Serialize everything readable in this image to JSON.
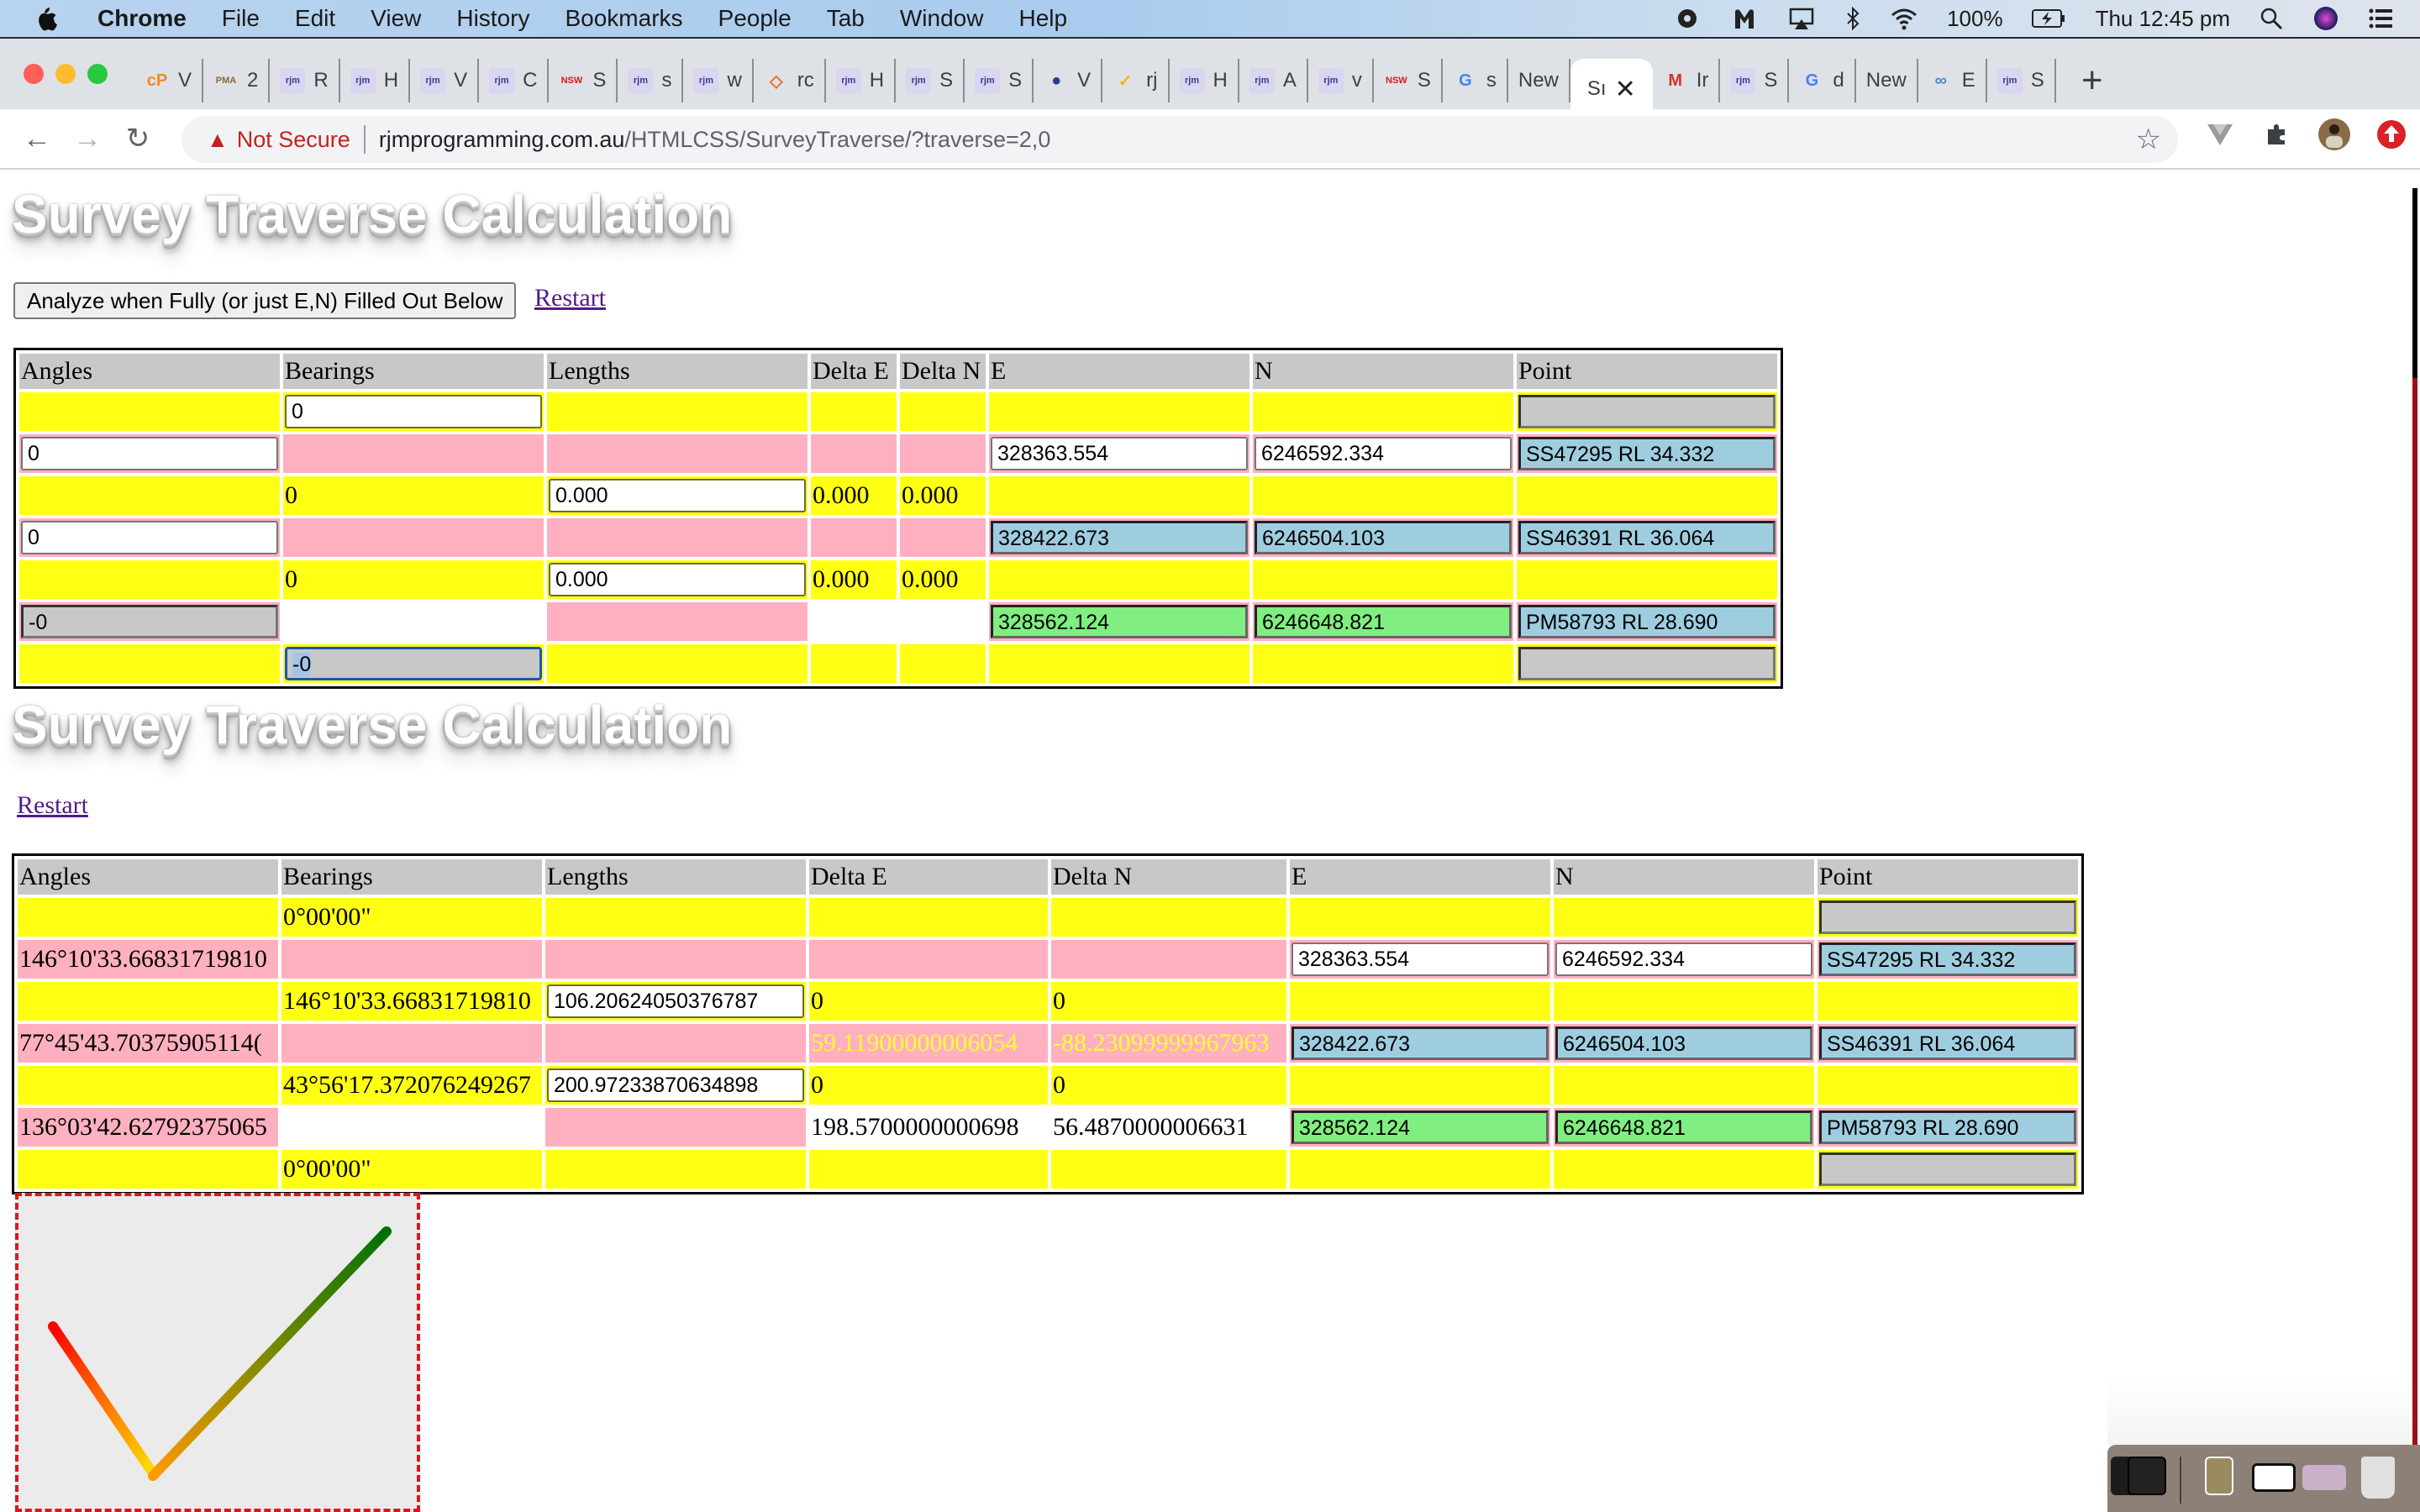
{
  "menubar": {
    "app": "Chrome",
    "items": [
      "File",
      "Edit",
      "View",
      "History",
      "Bookmarks",
      "People",
      "Tab",
      "Window",
      "Help"
    ],
    "battery": "100%",
    "clock": "Thu 12:45 pm"
  },
  "tabs": [
    {
      "fav": "cP",
      "label": "V",
      "color": "#f08a24"
    },
    {
      "fav": "PMA",
      "label": "2",
      "color": "#8a6a3a"
    },
    {
      "fav": "rjm",
      "label": "R",
      "color": "#3a3a8a"
    },
    {
      "fav": "rjm",
      "label": "H",
      "color": "#3a3a8a"
    },
    {
      "fav": "rjm",
      "label": "V",
      "color": "#3a3a8a"
    },
    {
      "fav": "rjm",
      "label": "C",
      "color": "#3a3a8a"
    },
    {
      "fav": "NSW",
      "label": "S",
      "color": "#d7191c"
    },
    {
      "fav": "rjm",
      "label": "s",
      "color": "#3a3a8a"
    },
    {
      "fav": "rjm",
      "label": "w",
      "color": "#3a3a8a"
    },
    {
      "fav": "◇",
      "label": "rc",
      "color": "#f06a24"
    },
    {
      "fav": "rjm",
      "label": "H",
      "color": "#3a3a8a"
    },
    {
      "fav": "rjm",
      "label": "S",
      "color": "#3a3a8a"
    },
    {
      "fav": "rjm",
      "label": "S",
      "color": "#3a3a8a"
    },
    {
      "fav": "●",
      "label": "V",
      "color": "#2a3f8a"
    },
    {
      "fav": "✓",
      "label": "rj",
      "color": "#f2b418"
    },
    {
      "fav": "rjm",
      "label": "H",
      "color": "#3a3a8a"
    },
    {
      "fav": "rjm",
      "label": "A",
      "color": "#3a3a8a"
    },
    {
      "fav": "rjm",
      "label": "v",
      "color": "#3a3a8a"
    },
    {
      "fav": "NSW",
      "label": "S",
      "color": "#d7191c"
    },
    {
      "fav": "G",
      "label": "s",
      "color": "#4285f4"
    },
    {
      "fav": "",
      "label": "New",
      "color": ""
    },
    {
      "fav": "",
      "label": "Sı",
      "color": "",
      "active": true
    },
    {
      "fav": "M",
      "label": "Ir",
      "color": "#d93025"
    },
    {
      "fav": "rjm",
      "label": "S",
      "color": "#3a3a8a"
    },
    {
      "fav": "G",
      "label": "d",
      "color": "#4285f4"
    },
    {
      "fav": "",
      "label": "New",
      "color": ""
    },
    {
      "fav": "∞",
      "label": "E",
      "color": "#4a8ad8"
    },
    {
      "fav": "rjm",
      "label": "S",
      "color": "#3a3a8a"
    }
  ],
  "toolbar": {
    "security_label": "Not Secure",
    "url_host": "rjmprogramming.com.au",
    "url_path": "/HTMLCSS/SurveyTraverse/?traverse=2,0"
  },
  "section1": {
    "title": "Survey Traverse Calculation",
    "analyze_button": "Analyze when Fully (or just E,N) Filled Out Below",
    "restart_link": "Restart",
    "headers": [
      "Angles",
      "Bearings",
      "Lengths",
      "Delta E",
      "Delta N",
      "E",
      "N",
      "Point"
    ],
    "rows": {
      "r0_bearing": "0",
      "r1_angle": "0",
      "r1_e": "328363.554",
      "r1_n": "6246592.334",
      "r1_point": "SS47295 RL 34.332",
      "r2_bearing": "0",
      "r2_length": "0.000",
      "r2_de": "0.000",
      "r2_dn": "0.000",
      "r3_angle": "0",
      "r3_e": "328422.673",
      "r3_n": "6246504.103",
      "r3_point": "SS46391 RL 36.064",
      "r4_bearing": "0",
      "r4_length": "0.000",
      "r4_de": "0.000",
      "r4_dn": "0.000",
      "r5_angle": "-0",
      "r5_e": "328562.124",
      "r5_n": "6246648.821",
      "r5_point": "PM58793 RL 28.690",
      "r6_bearing": "-0"
    }
  },
  "section2": {
    "title": "Survey Traverse Calculation",
    "restart_link": "Restart",
    "headers": [
      "Angles",
      "Bearings",
      "Lengths",
      "Delta E",
      "Delta N",
      "E",
      "N",
      "Point"
    ],
    "rows": {
      "r0_bearing": "0°00'00\"",
      "r1_angle": "146°10'33.66831719810",
      "r2_bearing": "146°10'33.66831719810",
      "r2_length": "106.20624050376787",
      "r2_de": "0",
      "r2_dn": "0",
      "r1_e": "328363.554",
      "r1_n": "6246592.334",
      "r1_point": "SS47295 RL 34.332",
      "r3_angle": "77°45'43.70375905114(",
      "r3_de": "59.11900000006054",
      "r3_dn": "-88.23099999967963",
      "r3_e": "328422.673",
      "r3_n": "6246504.103",
      "r3_point": "SS46391 RL 36.064",
      "r4_bearing": "43°56'17.372076249267",
      "r4_length": "200.97233870634898",
      "r4_de": "0",
      "r4_dn": "0",
      "r5_angle": "136°03'42.62792375065",
      "r5_de": "198.5700000000698",
      "r5_dn": "56.4870000006631",
      "r5_e": "328562.124",
      "r5_n": "6246648.821",
      "r5_point": "PM58793 RL 28.690",
      "r6_bearing": "0°00'00\""
    }
  },
  "colors": {
    "forward_row": "#ffff14",
    "angle_row": "#ffb0c0",
    "known_point": "#9fcde0",
    "closing_point": "#80ee80",
    "canvas_border": "#e0141e"
  },
  "canvas": {
    "icon": "checkmark-gradient",
    "gradient_start": "#ff0000",
    "gradient_mid": "#ffe000",
    "gradient_end": "#007000"
  }
}
